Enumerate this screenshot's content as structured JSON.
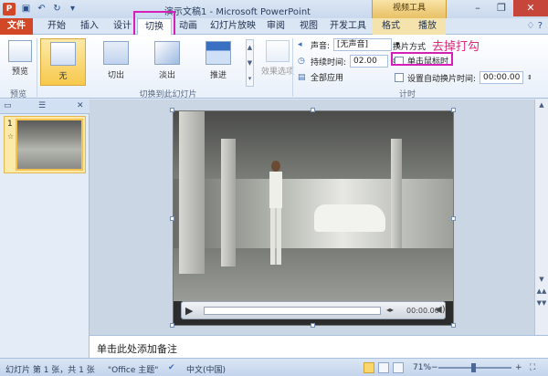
{
  "app": {
    "title": "演示文稿1 - Microsoft PowerPoint",
    "context_tool": "视频工具",
    "quick_access": [
      "save-icon",
      "undo-icon",
      "redo-icon",
      "customize-icon"
    ]
  },
  "window_controls": [
    "minimize-icon",
    "restore-icon",
    "close-icon"
  ],
  "tabs": {
    "file": "文件",
    "items": [
      "开始",
      "插入",
      "设计",
      "切换",
      "动画",
      "幻灯片放映",
      "审阅",
      "视图",
      "开发工具",
      "格式",
      "播放"
    ],
    "active": "切换"
  },
  "ribbon": {
    "preview": {
      "label": "预览",
      "group": "预览"
    },
    "transitions": {
      "items": [
        "无",
        "切出",
        "淡出",
        "推进"
      ],
      "selected": "无",
      "effect_options": "效果选项",
      "group": "切换到此幻灯片"
    },
    "timing": {
      "sound_label": "声音:",
      "sound_value": "[无声音]",
      "duration_label": "持续时间:",
      "duration_value": "02.00",
      "apply_all": "全部应用",
      "advance_label": "换片方式",
      "on_click_label": "单击鼠标时",
      "on_click_checked": false,
      "after_label": "设置自动换片时间:",
      "after_checked": false,
      "after_value": "00:00.00",
      "group": "计时"
    },
    "annotation": "去掉打勾"
  },
  "left_pane": {
    "slide_number": "1",
    "slide_marker": "☆"
  },
  "video": {
    "timecode": "00:00.00"
  },
  "notes": {
    "placeholder": "单击此处添加备注"
  },
  "status": {
    "slide_info": "幻灯片 第 1 张，共 1 张",
    "theme": "\"Office 主题\"",
    "language": "中文(中国)",
    "zoom": "71%"
  }
}
